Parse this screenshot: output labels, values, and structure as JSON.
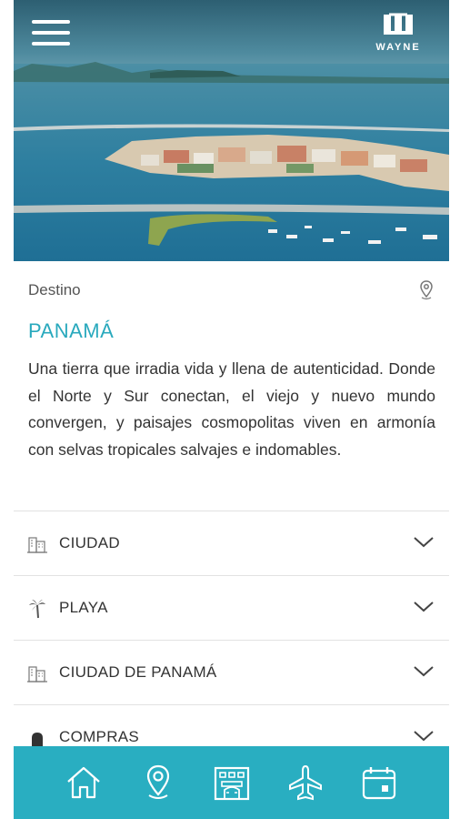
{
  "header": {
    "logo_text": "WAYNE",
    "menu_icon": "hamburger-menu-icon"
  },
  "destination": {
    "label": "Destino",
    "name": "PANAMÁ",
    "description": "Una tierra que irradia vida y llena de autenticidad. Donde el Norte y Sur conectan, el viejo y nuevo mundo convergen, y paisajes cosmopolitas viven en armonía con selvas tropicales salvajes e indomables.",
    "location_icon": "location-pin-icon"
  },
  "accordion": [
    {
      "label": "CIUDAD",
      "icon": "city-buildings-icon"
    },
    {
      "label": "PLAYA",
      "icon": "palm-tree-icon"
    },
    {
      "label": "CIUDAD DE PANAMÁ",
      "icon": "city-buildings-icon"
    },
    {
      "label": "COMPRAS",
      "icon": "shopping-bag-icon"
    }
  ],
  "bottom_nav": [
    {
      "name": "home",
      "icon": "home-icon"
    },
    {
      "name": "destinations",
      "icon": "location-pin-icon",
      "active": true
    },
    {
      "name": "hotels",
      "icon": "hotel-icon"
    },
    {
      "name": "flights",
      "icon": "airplane-icon"
    },
    {
      "name": "calendar",
      "icon": "calendar-icon"
    }
  ],
  "colors": {
    "accent": "#29aec1",
    "title": "#29a9bd",
    "text": "#333333"
  }
}
